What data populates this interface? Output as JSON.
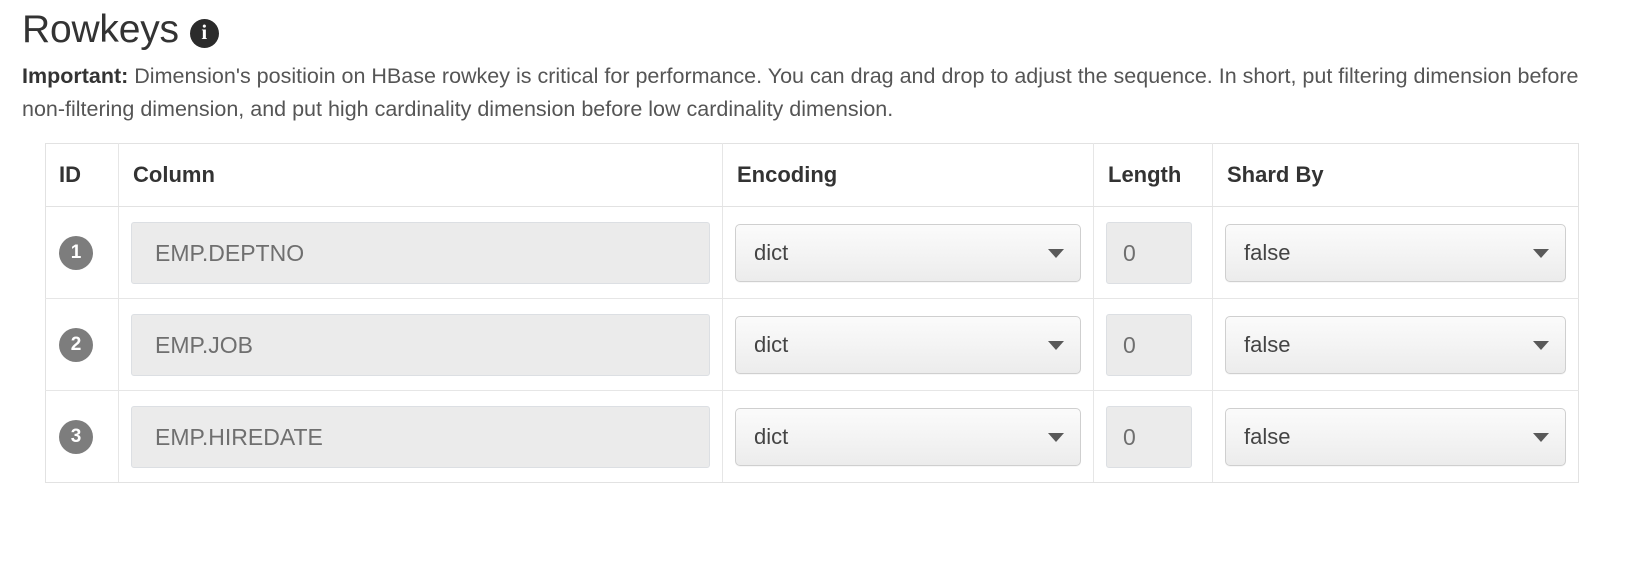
{
  "header": {
    "title": "Rowkeys",
    "info_icon": "info-icon",
    "info_glyph": "i"
  },
  "description": {
    "label": "Important:",
    "text": " Dimension's positioin on HBase rowkey is critical for performance. You can drag and drop to adjust the sequence. In short, put filtering dimension before non-filtering dimension, and put high cardinality dimension before low cardinality dimension."
  },
  "table": {
    "columns": [
      {
        "key": "id",
        "label": "ID"
      },
      {
        "key": "column",
        "label": "Column"
      },
      {
        "key": "encoding",
        "label": "Encoding"
      },
      {
        "key": "length",
        "label": "Length"
      },
      {
        "key": "shard_by",
        "label": "Shard By"
      }
    ],
    "rows": [
      {
        "id": "1",
        "column": "EMP.DEPTNO",
        "encoding": "dict",
        "length": "0",
        "shard_by": "false"
      },
      {
        "id": "2",
        "column": "EMP.JOB",
        "encoding": "dict",
        "length": "0",
        "shard_by": "false"
      },
      {
        "id": "3",
        "column": "EMP.HIREDATE",
        "encoding": "dict",
        "length": "0",
        "shard_by": "false"
      }
    ]
  },
  "colors": {
    "page_bg": "#ffffff",
    "title_text": "#333333",
    "body_text": "#555555",
    "table_border": "#e2e2e2",
    "cell_border": "#e6e6e6",
    "input_bg": "#ebebeb",
    "input_text": "#6f6f6f",
    "badge_bg": "#7d7d7d",
    "info_icon_bg": "#2b2b2b"
  }
}
